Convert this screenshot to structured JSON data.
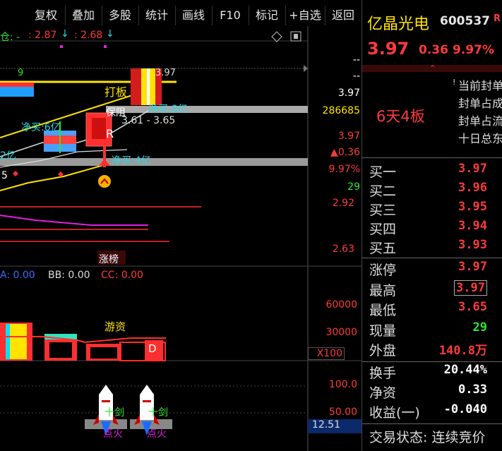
{
  "toolbar": {
    "buttons": [
      "复权",
      "叠加",
      "多股",
      "统计",
      "画线",
      "F10",
      "标记",
      "+自选",
      "返回"
    ]
  },
  "chart": {
    "header_prefix": "仓: -",
    "header_val1": ": 2.87",
    "header_val2": ": 2.68",
    "price_axis": [
      "--",
      "--",
      "3.97",
      "286685",
      "3.97",
      "▲0.36",
      "9.97%",
      "29",
      "2.92",
      "2.63"
    ],
    "label_9": "9",
    "label_397": "3.97",
    "label_dajia": "打板",
    "label_baozu": "保阻",
    "label_range": "3.61 - 3.65",
    "label_jingmai8": "净买:8亿",
    "label_jingmai6": "净买:6亿",
    "label_jingmai4": "净买:4亿",
    "label_2yi": "2亿",
    "label_5": "5",
    "label_R": "R",
    "label_zhangbang": "涨榜",
    "indicator": {
      "aa": "A: 0.00",
      "bb": "BB: 0.00",
      "cc": "CC: 0.00"
    },
    "vol_axis": [
      "60000",
      "30000",
      "X100"
    ],
    "label_youzi": "游资",
    "label_D": "D",
    "bottom_axis": [
      "100.0",
      "50.00",
      "12.51"
    ],
    "rocket_labels": [
      "十剑",
      "十剑",
      "点火",
      "点火"
    ]
  },
  "quote": {
    "name": "亿晶光电",
    "code": "600537",
    "badge": "R",
    "price": "3.97",
    "change": "0.36",
    "pct": "9.97%",
    "board_label": "6天4板",
    "notes": [
      "当前封单",
      "封单占成",
      "封单占流",
      "十日总东"
    ],
    "bids": [
      {
        "k": "买一",
        "v": "3.97"
      },
      {
        "k": "买二",
        "v": "3.96"
      },
      {
        "k": "买三",
        "v": "3.95"
      },
      {
        "k": "买四",
        "v": "3.94"
      },
      {
        "k": "买五",
        "v": "3.93"
      }
    ],
    "stats": [
      {
        "k": "涨停",
        "v": "3.97",
        "c": "red"
      },
      {
        "k": "最高",
        "v": "3.97",
        "c": "red"
      },
      {
        "k": "最低",
        "v": "3.65",
        "c": "red"
      },
      {
        "k": "现量",
        "v": "29",
        "c": "green"
      },
      {
        "k": "外盘",
        "v": "140.8万",
        "c": "red"
      }
    ],
    "fin": [
      {
        "k": "换手",
        "v": "20.44%",
        "c": "white"
      },
      {
        "k": "净资",
        "v": "0.33",
        "c": "white"
      },
      {
        "k": "收益(一)",
        "v": "-0.040",
        "c": "white"
      }
    ],
    "status": "交易状态: 连续竞价"
  },
  "colors": {
    "up": "#ff3b3b",
    "down": "#2ee52e",
    "accent": "#ffe400"
  }
}
